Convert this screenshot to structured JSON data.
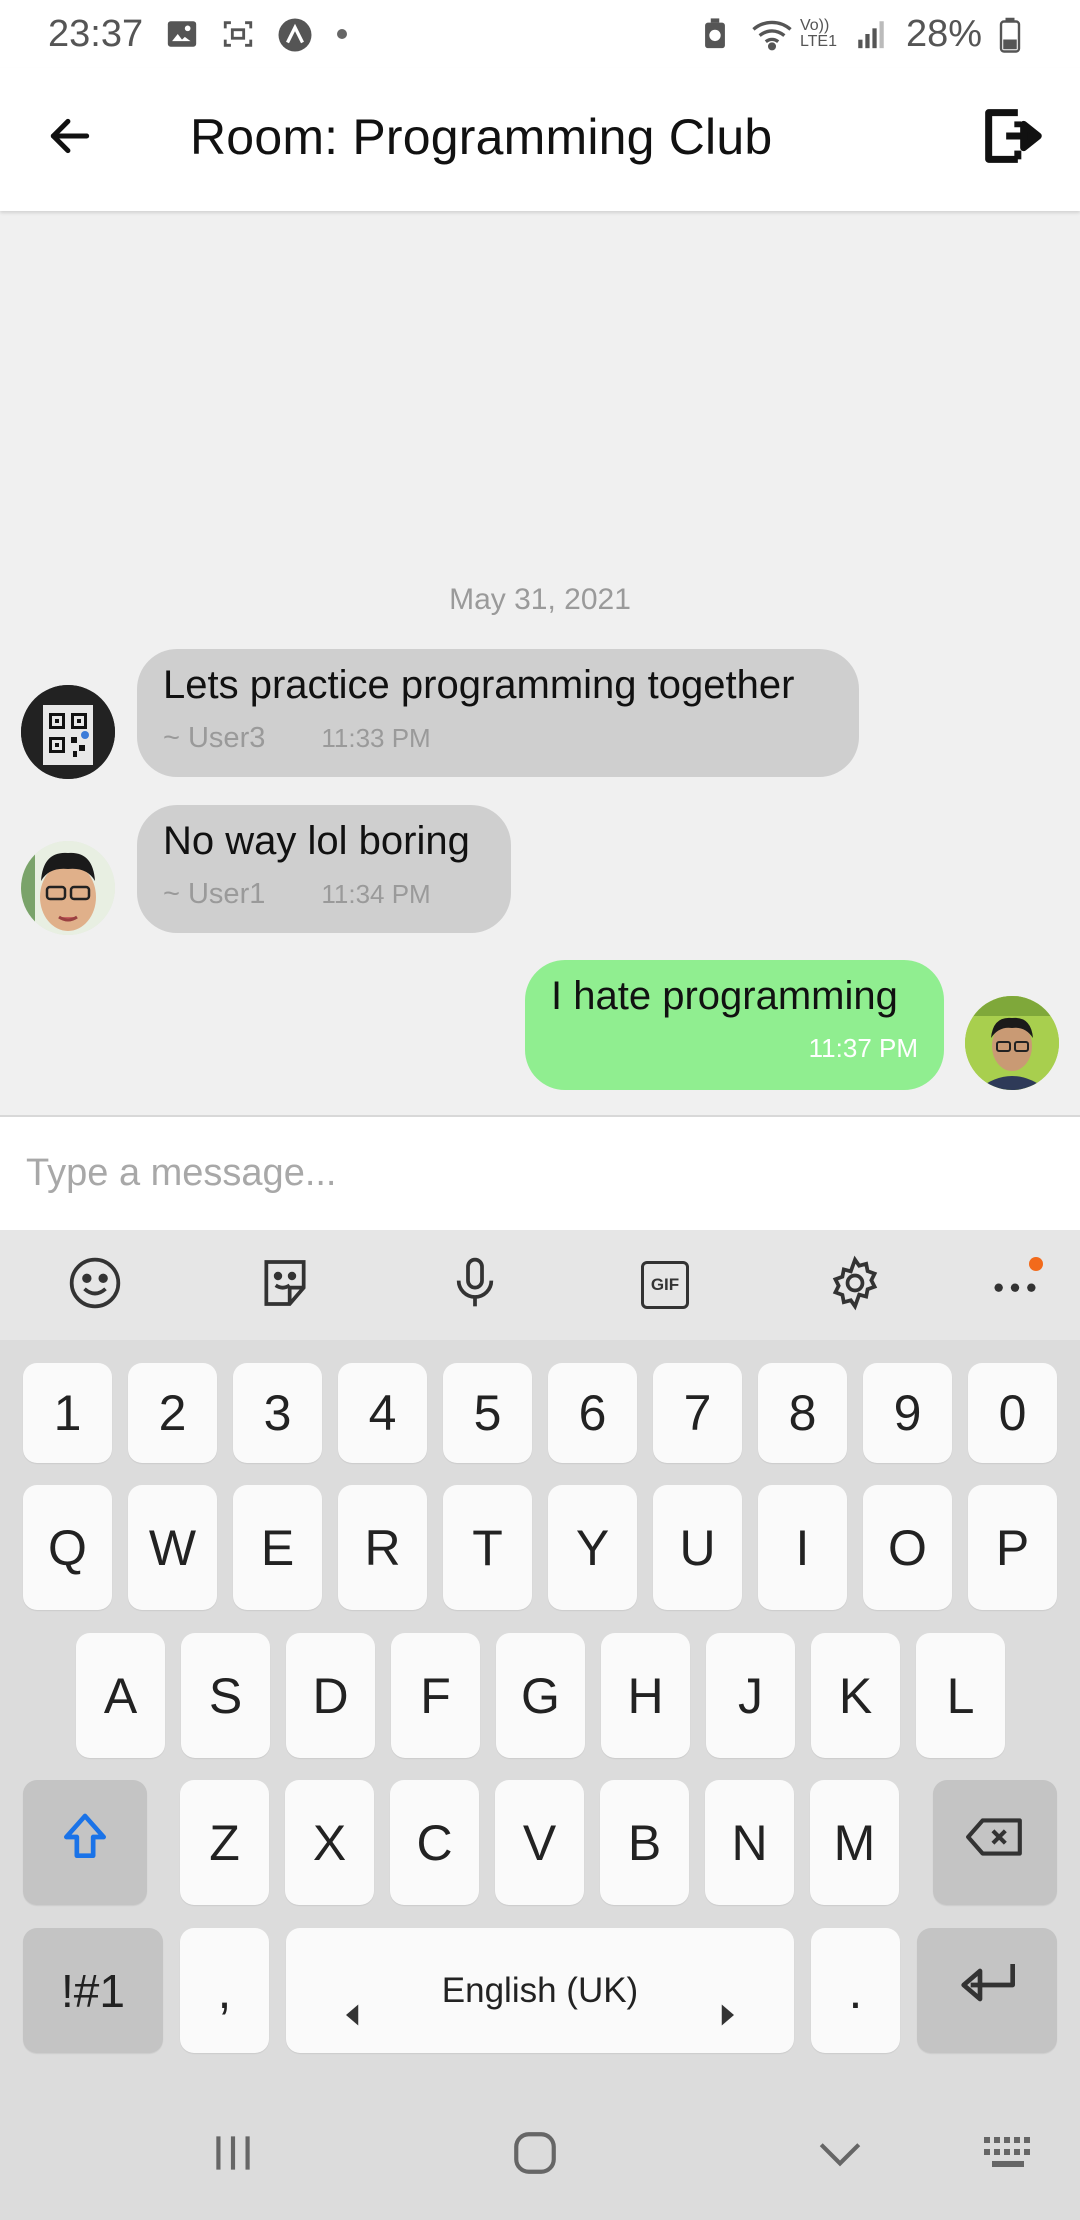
{
  "status_bar": {
    "time": "23:37",
    "battery": "28%",
    "volte_label": "Vo)) LTE1"
  },
  "header": {
    "title": "Room: Programming Club",
    "back_icon": "arrow-left-icon",
    "logout_icon": "logout-icon"
  },
  "chat": {
    "date_separator": "May 31, 2021",
    "messages": [
      {
        "direction": "incoming",
        "text": "Lets practice programming together",
        "sender": "~ User3",
        "time": "11:33 PM"
      },
      {
        "direction": "incoming",
        "text": "No way lol boring",
        "sender": "~ User1",
        "time": "11:34 PM"
      },
      {
        "direction": "outgoing",
        "text": "I hate programming",
        "sender": "",
        "time": "11:37 PM"
      }
    ]
  },
  "composer": {
    "placeholder": "Type a message..."
  },
  "keyboard": {
    "toolbar_icons": [
      "emoji-icon",
      "sticker-icon",
      "microphone-icon",
      "gif-icon",
      "settings-icon",
      "more-icon"
    ],
    "number_row": [
      "1",
      "2",
      "3",
      "4",
      "5",
      "6",
      "7",
      "8",
      "9",
      "0"
    ],
    "row1": [
      "Q",
      "W",
      "E",
      "R",
      "T",
      "Y",
      "U",
      "I",
      "O",
      "P"
    ],
    "row2": [
      "A",
      "S",
      "D",
      "F",
      "G",
      "H",
      "J",
      "K",
      "L"
    ],
    "row3": [
      "Z",
      "X",
      "C",
      "V",
      "B",
      "N",
      "M"
    ],
    "symbols_key": "!#1",
    "comma_key": ",",
    "space_label": "English (UK)",
    "period_key": ".",
    "gif_label": "GIF"
  },
  "colors": {
    "incoming_bubble": "#cfcfcf",
    "outgoing_bubble": "#90ee90",
    "background": "#f0f0f0",
    "accent_shift": "#1a73e8",
    "notification_dot": "#f26a1b"
  }
}
